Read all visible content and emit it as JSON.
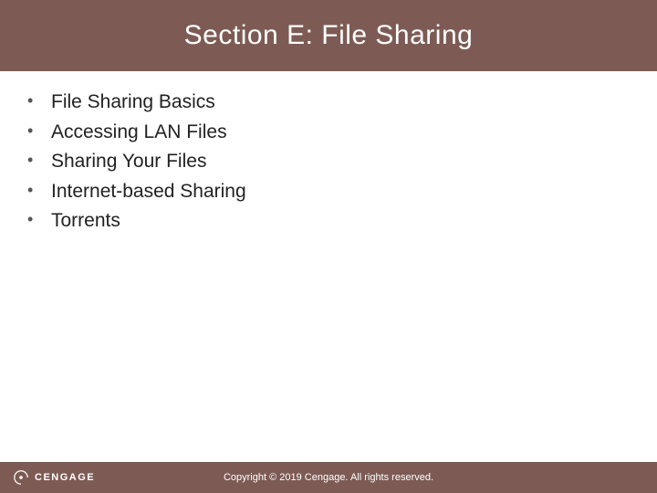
{
  "header": {
    "title": "Section E: File Sharing"
  },
  "content": {
    "items": [
      "File Sharing Basics",
      "Accessing LAN Files",
      "Sharing Your Files",
      "Internet-based Sharing",
      "Torrents"
    ]
  },
  "footer": {
    "brand": "CENGAGE",
    "copyright": "Copyright © 2019 Cengage. All rights reserved."
  },
  "colors": {
    "band": "#7d5b54",
    "text": "#222222",
    "footer_text": "#ffffff"
  }
}
